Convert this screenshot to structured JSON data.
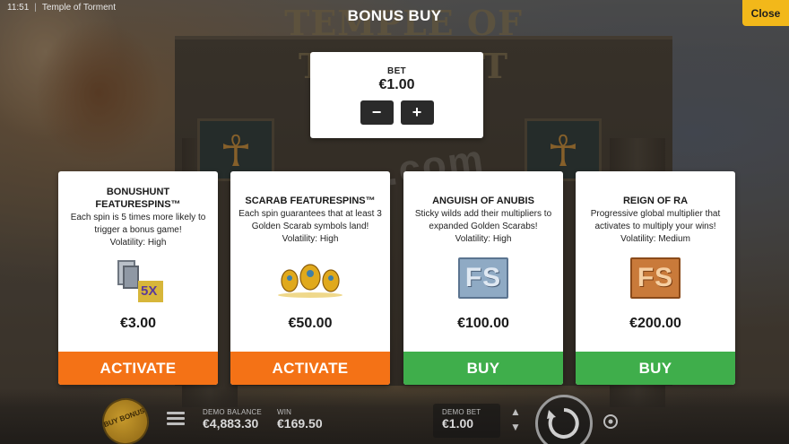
{
  "top_bar": {
    "time": "11:51",
    "separator": "|",
    "game_name": "Temple of Torment"
  },
  "overlay": {
    "title": "BONUS BUY",
    "close_label": "Close"
  },
  "background": {
    "logo_text": "TEMPLE OF TORMENT",
    "watermark": ".com"
  },
  "bet": {
    "label": "BET",
    "value": "€1.00",
    "minus": "−",
    "plus": "+"
  },
  "cards": [
    {
      "name": "BONUSHUNT FEATURESPINS™",
      "description": "Each spin is 5 times more likely to trigger a bonus game!",
      "volatility": "Volatility: High",
      "price": "€3.00",
      "action": "ACTIVATE",
      "art_icon": "bonushunt-5x-icon",
      "art_text": "5X"
    },
    {
      "name": "SCARAB FEATURESPINS™",
      "description": "Each spin guarantees that at least 3 Golden Scarab symbols land!",
      "volatility": "Volatility: High",
      "price": "€50.00",
      "action": "ACTIVATE",
      "art_icon": "golden-scarabs-icon"
    },
    {
      "name": "ANGUISH OF ANUBIS",
      "description": "Sticky wilds add their multipliers to expanded Golden Scarabs!",
      "volatility": "Volatility: High",
      "price": "€100.00",
      "action": "BUY",
      "art_icon": "stone-fs-icon",
      "art_text": "FS"
    },
    {
      "name": "REIGN OF RA",
      "description": "Progressive global multiplier that activates to multiply your wins!",
      "volatility": "Volatility: Medium",
      "price": "€200.00",
      "action": "BUY",
      "art_icon": "bronze-fs-icon",
      "art_text": "FS"
    }
  ],
  "bottom_bar": {
    "buy_bonus_label": "BUY BONUS",
    "demo_balance_label": "DEMO BALANCE",
    "demo_balance_value": "€4,883.30",
    "win_label": "WIN",
    "win_value": "€169.50",
    "demo_bet_label": "DEMO BET",
    "demo_bet_value": "€1.00"
  },
  "colors": {
    "activate": "#f47216",
    "buy": "#3fae4b",
    "close": "#f2b81a"
  }
}
